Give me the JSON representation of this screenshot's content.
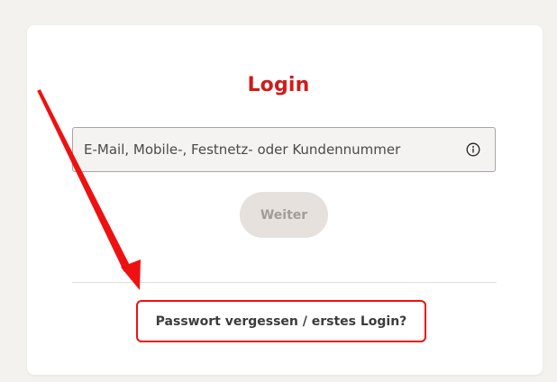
{
  "login": {
    "title": "Login",
    "identifier_placeholder": "E-Mail, Mobile-, Festnetz- oder Kundennummer",
    "identifier_value": "",
    "next_button_label": "Weiter",
    "forgot_link_label": "Passwort vergessen / erstes Login?"
  },
  "icons": {
    "info": "info-circle-icon"
  },
  "colors": {
    "brand_red": "#d11a1a",
    "annotation_red": "#ee1111",
    "button_disabled_bg": "#e6e1dc",
    "button_disabled_text": "#a29d98",
    "page_bg": "#f4f2ef"
  }
}
